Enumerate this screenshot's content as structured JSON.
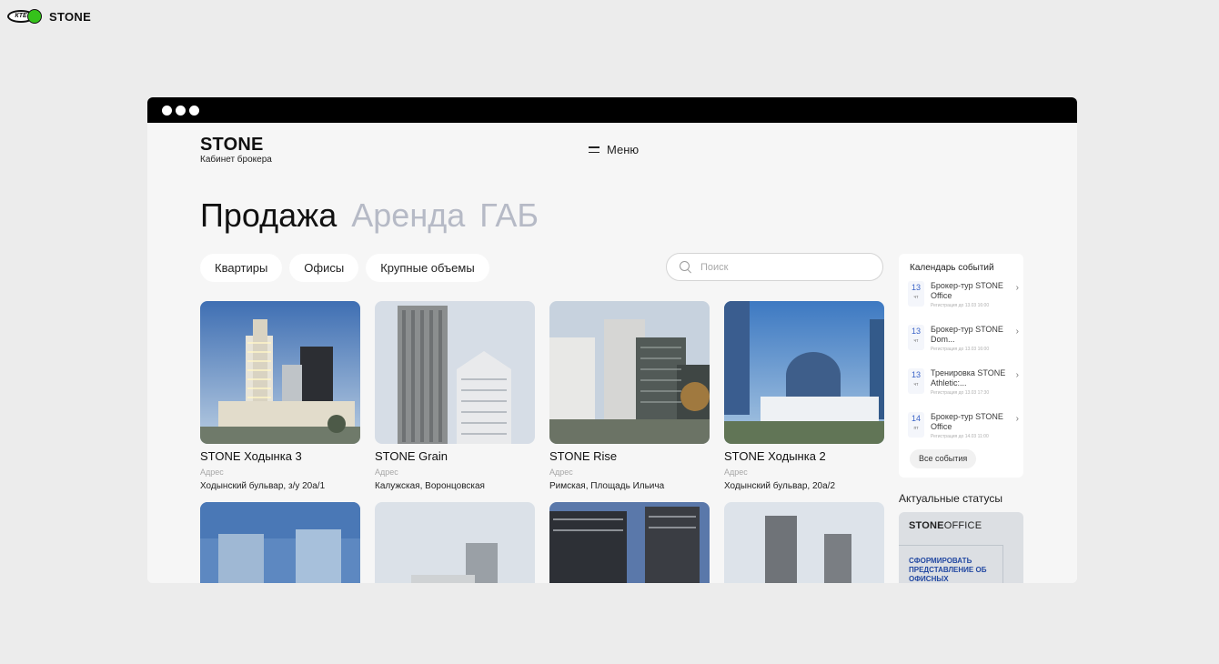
{
  "top_brand": {
    "kte_text": "КТЕ",
    "stone": "STONE"
  },
  "header": {
    "logo": "STONE",
    "logo_sub": "Кабинет брокера",
    "menu_label": "Меню"
  },
  "big_tabs": [
    {
      "label": "Продажа",
      "active": true
    },
    {
      "label": "Аренда",
      "active": false
    },
    {
      "label": "ГАБ",
      "active": false
    }
  ],
  "filters": [
    "Квартиры",
    "Офисы",
    "Крупные объемы"
  ],
  "search": {
    "placeholder": "Поиск"
  },
  "projects": [
    {
      "title": "STONE Ходынка 3",
      "addr_label": "Адрес",
      "address": "Ходынский бульвар, з/у 20а/1"
    },
    {
      "title": "STONE Grain",
      "addr_label": "Адрес",
      "address": "Калужская, Воронцовская"
    },
    {
      "title": "STONE Rise",
      "addr_label": "Адрес",
      "address": "Римская, Площадь Ильича"
    },
    {
      "title": "STONE Ходынка 2",
      "addr_label": "Адрес",
      "address": "Ходынский бульвар, 20а/2"
    }
  ],
  "events": {
    "title": "Календарь событий",
    "items": [
      {
        "day": "13",
        "weekday": "чт",
        "name": "Брокер-тур STONE Office",
        "reg": "Регистрация до 13.03 16:00"
      },
      {
        "day": "13",
        "weekday": "чт",
        "name": "Брокер-тур STONE Dom...",
        "reg": "Регистрация до 13.03 16:00"
      },
      {
        "day": "13",
        "weekday": "чт",
        "name": "Тренировка STONE Athletic:...",
        "reg": "Регистрация до 13.03 17:30"
      },
      {
        "day": "14",
        "weekday": "пт",
        "name": "Брокер-тур STONE Office",
        "reg": "Регистрация до 14.03 11:00"
      }
    ],
    "all_label": "Все события"
  },
  "statuses": {
    "title": "Актуальные статусы",
    "banner_logo_bold": "STONE",
    "banner_logo_rest": "OFFICE",
    "banner_text": "СФОРМИРОВАТЬ ПРЕДСТАВЛЕНИЕ ОБ ОФИСНЫХ"
  },
  "colors": {
    "accent_blue": "#2248a2",
    "inactive_tab": "#b6bac6",
    "frame_bar": "#000000"
  }
}
